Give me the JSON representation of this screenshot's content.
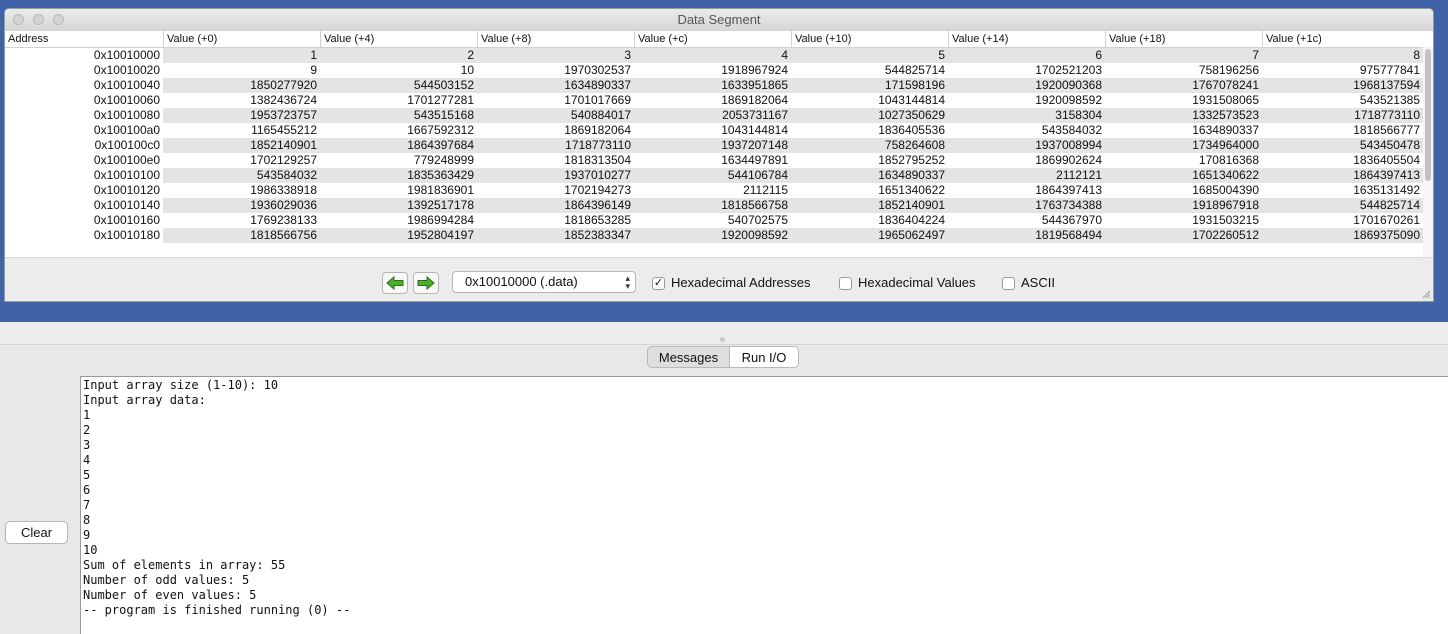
{
  "window": {
    "title": "Data Segment"
  },
  "table": {
    "columns": [
      "Address",
      "Value (+0)",
      "Value (+4)",
      "Value (+8)",
      "Value (+c)",
      "Value (+10)",
      "Value (+14)",
      "Value (+18)",
      "Value (+1c)"
    ],
    "rows": [
      [
        "0x10010000",
        "1",
        "2",
        "3",
        "4",
        "5",
        "6",
        "7",
        "8"
      ],
      [
        "0x10010020",
        "9",
        "10",
        "1970302537",
        "1918967924",
        "544825714",
        "1702521203",
        "758196256",
        "975777841"
      ],
      [
        "0x10010040",
        "1850277920",
        "544503152",
        "1634890337",
        "1633951865",
        "171598196",
        "1920090368",
        "1767078241",
        "1968137594"
      ],
      [
        "0x10010060",
        "1382436724",
        "1701277281",
        "1701017669",
        "1869182064",
        "1043144814",
        "1920098592",
        "1931508065",
        "543521385"
      ],
      [
        "0x10010080",
        "1953723757",
        "543515168",
        "540884017",
        "2053731167",
        "1027350629",
        "3158304",
        "1332573523",
        "1718773110"
      ],
      [
        "0x100100a0",
        "1165455212",
        "1667592312",
        "1869182064",
        "1043144814",
        "1836405536",
        "543584032",
        "1634890337",
        "1818566777"
      ],
      [
        "0x100100c0",
        "1852140901",
        "1864397684",
        "1718773110",
        "1937207148",
        "758264608",
        "1937008994",
        "1734964000",
        "543450478"
      ],
      [
        "0x100100e0",
        "1702129257",
        "779248999",
        "1818313504",
        "1634497891",
        "1852795252",
        "1869902624",
        "170816368",
        "1836405504"
      ],
      [
        "0x10010100",
        "543584032",
        "1835363429",
        "1937010277",
        "544106784",
        "1634890337",
        "2112121",
        "1651340622",
        "1864397413"
      ],
      [
        "0x10010120",
        "1986338918",
        "1981836901",
        "1702194273",
        "2112115",
        "1651340622",
        "1864397413",
        "1685004390",
        "1635131492"
      ],
      [
        "0x10010140",
        "1936029036",
        "1392517178",
        "1864396149",
        "1818566758",
        "1852140901",
        "1763734388",
        "1918967918",
        "544825714"
      ],
      [
        "0x10010160",
        "1769238133",
        "1986994284",
        "1818653285",
        "540702575",
        "1836404224",
        "544367970",
        "1931503215",
        "1701670261"
      ],
      [
        "0x10010180",
        "1818566756",
        "1952804197",
        "1852383347",
        "1920098592",
        "1965062497",
        "1819568494",
        "1702260512",
        "1869375090"
      ]
    ]
  },
  "controls": {
    "segment_select": "0x10010000 (.data)",
    "hex_addresses": {
      "label": "Hexadecimal Addresses",
      "checked": true,
      "mark": "✓"
    },
    "hex_values": {
      "label": "Hexadecimal Values",
      "checked": false
    },
    "ascii": {
      "label": "ASCII",
      "checked": false
    }
  },
  "tabs": {
    "messages": "Messages",
    "run_io": "Run I/O"
  },
  "clear_label": "Clear",
  "console": {
    "lines": [
      "Input array size (1-10): 10",
      "Input array data:",
      "1",
      "2",
      "3",
      "4",
      "5",
      "6",
      "7",
      "8",
      "9",
      "10",
      "Sum of elements in array: 55",
      "Number of odd values: 5",
      "Number of even values: 5",
      "-- program is finished running (0) --"
    ]
  },
  "colors": {
    "desktop": "#3f63a6",
    "arrow_green": "#4cae2e"
  }
}
